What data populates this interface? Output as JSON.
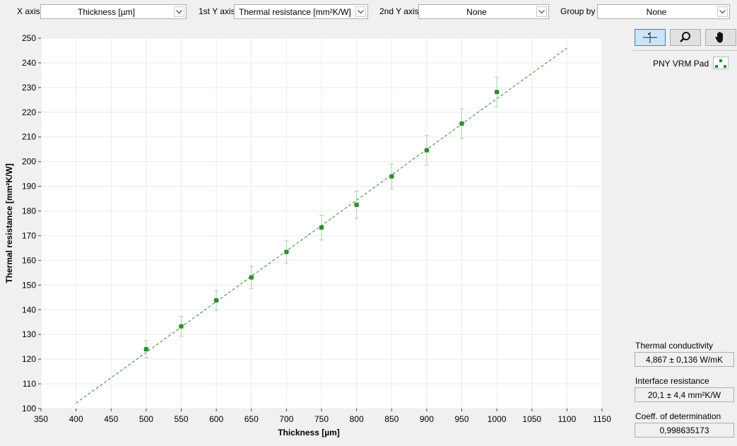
{
  "toolbar": {
    "x_axis_label": "X axis",
    "x_axis_value": "Thickness [µm]",
    "y1_axis_label": "1st Y axis",
    "y1_axis_value": "Thermal resistance [mm²K/W]",
    "y2_axis_label": "2nd Y axis",
    "y2_axis_value": "None",
    "group_by_label": "Group by",
    "group_by_value": "None"
  },
  "tools": {
    "crosshair_icon": "crosshair-icon",
    "zoom_icon": "magnifier-icon",
    "pan_icon": "hand-icon",
    "active": "crosshair"
  },
  "legend": {
    "series_name": "PNY VRM Pad"
  },
  "stats": {
    "conductivity_label": "Thermal conductivity",
    "conductivity_value": "4,867 ± 0,136 W/mK",
    "interface_label": "Interface resistance",
    "interface_value": "20,1 ± 4,4 mm²K/W",
    "r2_label": "Coeff. of determination",
    "r2_value": "0,998635173"
  },
  "colors": {
    "series": "#2e8b2e",
    "error_bar": "#a6d6a6",
    "fit_line": "#2e8b2e",
    "grid": "#ececec",
    "tool_active": "#cce4f7"
  },
  "chart_data": {
    "type": "scatter",
    "title": "",
    "xlabel": "Thickness [µm]",
    "ylabel": "Thermal resistance [mm²K/W]",
    "xlim": [
      350,
      1150
    ],
    "ylim": [
      100,
      250
    ],
    "xticks": [
      350,
      400,
      450,
      500,
      550,
      600,
      650,
      700,
      750,
      800,
      850,
      900,
      950,
      1000,
      1050,
      1100,
      1150
    ],
    "yticks": [
      100,
      110,
      120,
      130,
      140,
      150,
      160,
      170,
      180,
      190,
      200,
      210,
      220,
      230,
      240,
      250
    ],
    "grid": true,
    "series": [
      {
        "name": "PNY VRM Pad",
        "x": [
          500,
          550,
          600,
          650,
          700,
          750,
          800,
          850,
          900,
          950,
          1000
        ],
        "y": [
          124,
          133.3,
          143.8,
          153.1,
          163.4,
          173.3,
          182.5,
          194.0,
          204.6,
          215.4,
          228.2
        ],
        "y_err": [
          3.5,
          4.0,
          4.0,
          4.5,
          4.5,
          5.0,
          5.5,
          5.0,
          6.0,
          6.0,
          6.0
        ],
        "x_err": [
          5,
          5,
          5,
          5,
          5,
          5,
          5,
          5,
          5,
          5,
          5
        ]
      }
    ],
    "fit_line": {
      "x": [
        400,
        1100
      ],
      "y": [
        102.2,
        246.0
      ]
    }
  }
}
